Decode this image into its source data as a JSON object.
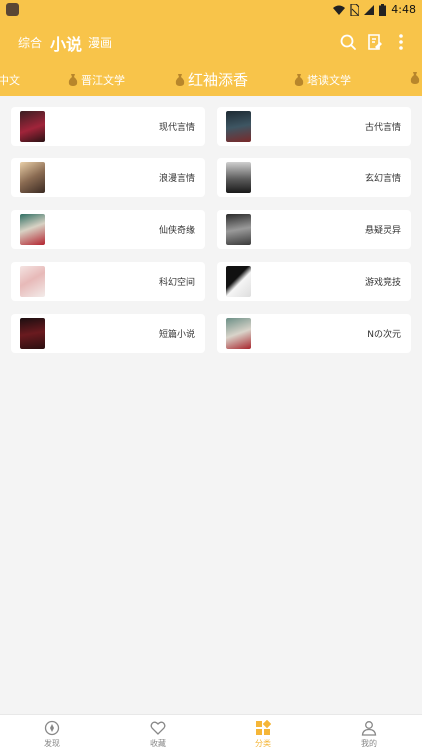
{
  "status_bar": {
    "time": "4:48"
  },
  "top_tabs": [
    "综合",
    "小说",
    "漫画"
  ],
  "source_tabs": [
    "中文",
    "晋江文学",
    "红袖添香",
    "塔读文学"
  ],
  "categories": [
    "现代言情",
    "古代言情",
    "浪漫言情",
    "玄幻言情",
    "仙侠奇缘",
    "悬疑灵异",
    "科幻空间",
    "游戏竞技",
    "短篇小说",
    "Nの次元"
  ],
  "bottom_nav": [
    "发现",
    "收藏",
    "分类",
    "我的"
  ],
  "colors": {
    "accent": "#f8c44a",
    "nav_active": "#f5b638"
  }
}
